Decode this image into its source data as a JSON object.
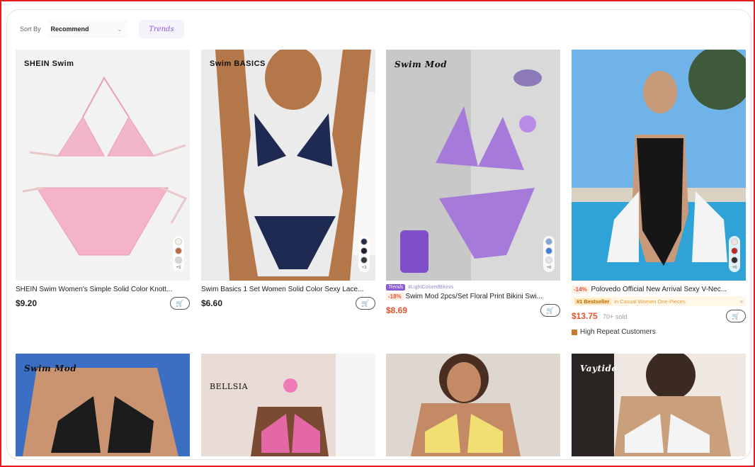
{
  "toolbar": {
    "sort_label": "Sort By",
    "sort_value": "Recommend",
    "trends_label": "Trends"
  },
  "products": [
    {
      "brand": "SHEIN Swim",
      "title": "SHEIN Swim Women's Simple Solid Color Knott...",
      "price": "$9.20",
      "swatch_colors": [
        "#f3efe9",
        "#b86a4a",
        "#d9d6d4"
      ],
      "swatch_more": "+5"
    },
    {
      "brand": "Swim BASICS",
      "title": "Swim Basics 1 Set Women Solid Color Sexy Lace...",
      "price": "$6.60",
      "swatch_colors": [
        "#2b2f46",
        "#1d2030",
        "#393939"
      ],
      "swatch_more": "+3"
    },
    {
      "brand": "Swim Mod",
      "trend_chip": "Trends",
      "trend_text": "#LightColoredBikinis",
      "discount": "-18%",
      "title": "Swim Mod 2pcs/Set Floral Print Bikini Swi...",
      "price": "$8.69",
      "swatch_colors": [
        "#7fa6d6",
        "#3f7ed6",
        "#e7e2ee"
      ],
      "swatch_more": "+6"
    },
    {
      "discount": "-14%",
      "title": "Polovedo Official New Arrival Sexy V-Nec...",
      "bestseller_chip": "#1 Bestseller",
      "bestseller_text": "in Casual Women One-Pieces",
      "bestseller_arrow": ">",
      "price": "$13.75",
      "sold": "70+ sold",
      "repeat_text": "High Repeat Customers",
      "swatch_colors": [
        "#e6e3e0",
        "#b22a2a",
        "#2f2f2f"
      ],
      "swatch_more": "+6"
    }
  ],
  "row2": [
    {
      "brand": "Swim Mod"
    },
    {
      "brand": "BELLSIA"
    },
    {
      "brand": ""
    },
    {
      "brand": "Vaytide"
    }
  ],
  "icons": {
    "cart": "add-to-cart-icon",
    "chevron": "chevron-down-icon"
  }
}
